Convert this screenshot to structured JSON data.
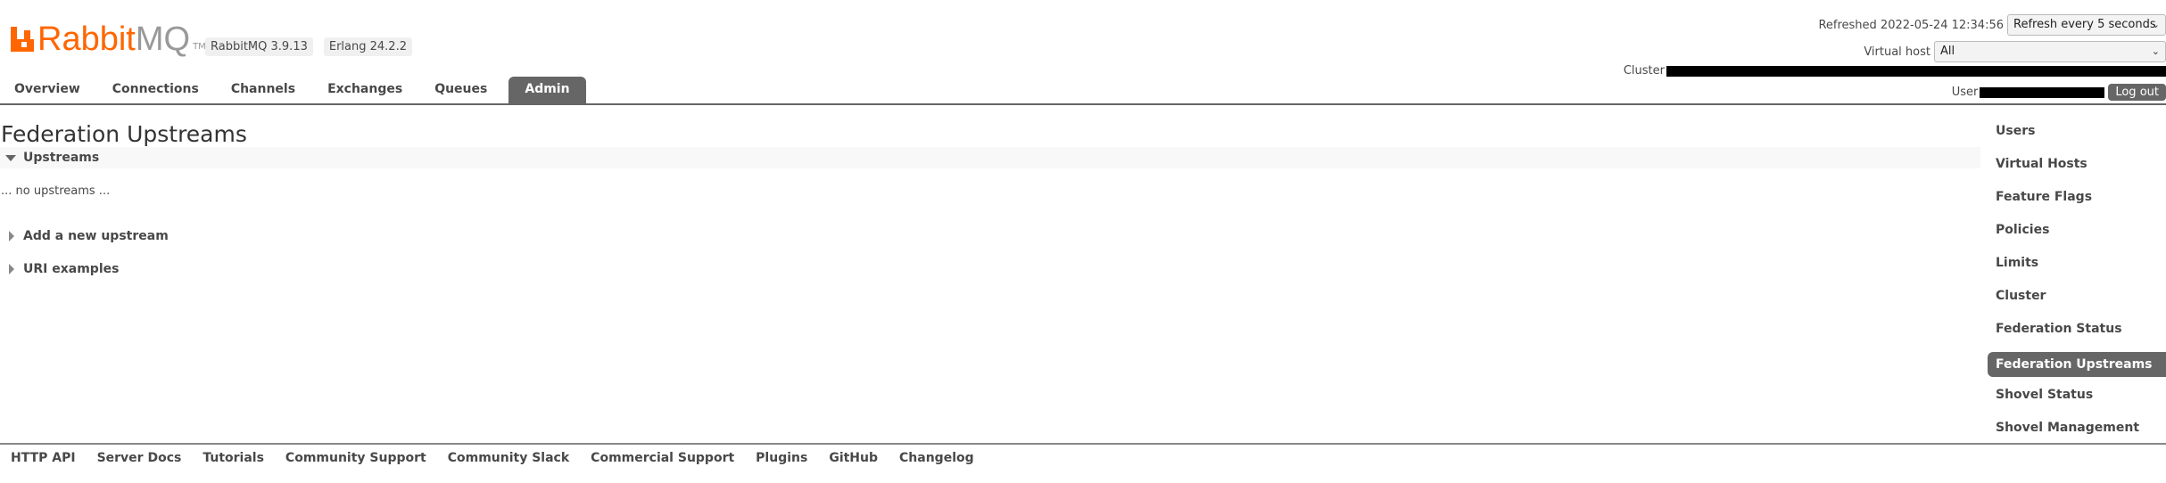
{
  "header": {
    "logo_brand": "Rabbit",
    "logo_suffix": "MQ",
    "logo_tm": "TM",
    "version": "RabbitMQ 3.9.13",
    "erlang": "Erlang 24.2.2",
    "refreshed": "Refreshed 2022-05-24 12:34:56",
    "refresh_select": "Refresh every 5 seconds",
    "vhost_label": "Virtual host",
    "vhost_select": "All",
    "cluster_label": "Cluster",
    "user_label": "User",
    "logout": "Log out"
  },
  "nav": {
    "tabs": [
      {
        "label": "Overview"
      },
      {
        "label": "Connections"
      },
      {
        "label": "Channels"
      },
      {
        "label": "Exchanges"
      },
      {
        "label": "Queues"
      },
      {
        "label": "Admin",
        "active": true
      }
    ]
  },
  "main": {
    "title": "Federation Upstreams",
    "upstreams_section": "Upstreams",
    "empty_message": "... no upstreams ...",
    "add_section": "Add a new upstream",
    "uri_section": "URI examples"
  },
  "sidebar": {
    "items": [
      {
        "label": "Users"
      },
      {
        "label": "Virtual Hosts"
      },
      {
        "label": "Feature Flags"
      },
      {
        "label": "Policies"
      },
      {
        "label": "Limits"
      },
      {
        "label": "Cluster"
      },
      {
        "label": "Federation Status"
      },
      {
        "label": "Federation Upstreams",
        "active": true
      },
      {
        "label": "Shovel Status"
      },
      {
        "label": "Shovel Management"
      }
    ]
  },
  "footer": {
    "links": [
      "HTTP API",
      "Server Docs",
      "Tutorials",
      "Community Support",
      "Community Slack",
      "Commercial Support",
      "Plugins",
      "GitHub",
      "Changelog"
    ]
  },
  "colors": {
    "brand": "#ff6600",
    "active_tab": "#666666"
  }
}
